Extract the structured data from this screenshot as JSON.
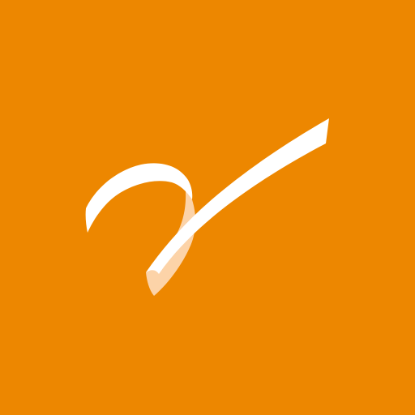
{
  "background": {
    "color": "#ED8700"
  },
  "logo": {
    "icon": "ribbon-swoosh-icon",
    "ribbon_color": "#FFFFFF",
    "ribbon_back_color": "#FCD3A8"
  }
}
